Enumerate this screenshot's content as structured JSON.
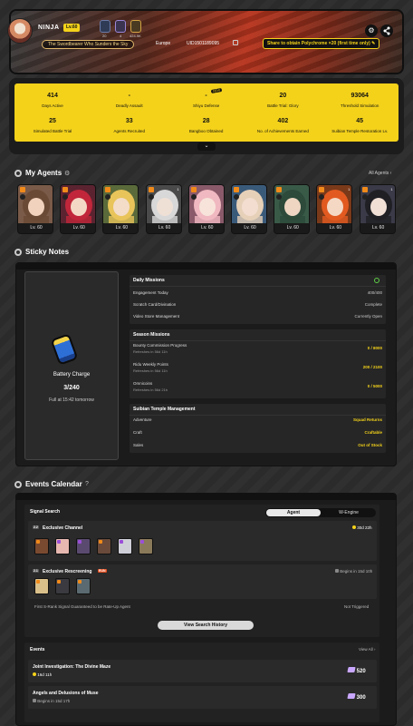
{
  "profile": {
    "name": "NINJA",
    "level": "Lv.60",
    "medals": [
      "20",
      "4",
      "424.9K"
    ],
    "title": "The Swordbearer Who Sunders the Sky",
    "region": "Europe",
    "uid": "UID1501189095",
    "share_promo": "Share to obtain Polychrome ×20 (first time only)"
  },
  "stats": [
    {
      "value": "414",
      "label": "Days Active"
    },
    {
      "value": "-",
      "label": "Deadly Assault"
    },
    {
      "value": "-",
      "label": "Shiyu Defense"
    },
    {
      "value": "20",
      "label": "Battle Trial: Glory"
    },
    {
      "value": "93064",
      "label": "Threshold Simulation"
    },
    {
      "value": "25",
      "label": "Simulated Battle Trial"
    },
    {
      "value": "33",
      "label": "Agents Recruited"
    },
    {
      "value": "28",
      "label": "Bangboo Obtained"
    },
    {
      "value": "402",
      "label": "No. of Achievements Earned"
    },
    {
      "value": "45",
      "label": "Suibian Temple Restoration Lv."
    }
  ],
  "new_tag": "NEW",
  "agents_section": {
    "title": "My Agents",
    "all_link": "All Agents",
    "agents": [
      {
        "level": "Lv. 60",
        "hair": "#6a4a35",
        "skin": "#f1d2bd",
        "bg": "#7a5a48",
        "cons": ""
      },
      {
        "level": "Lv. 60",
        "hair": "#c1263a",
        "skin": "#f4d8c6",
        "bg": "#5b2330",
        "cons": ""
      },
      {
        "level": "Lv. 60",
        "hair": "#e8c45a",
        "skin": "#f3dcc8",
        "bg": "#5a6a3a",
        "cons": ""
      },
      {
        "level": "Lv. 60",
        "hair": "#d8d8d8",
        "skin": "#efe0d6",
        "bg": "#4a4a4a",
        "cons": "1"
      },
      {
        "level": "Lv. 60",
        "hair": "#f0b8c0",
        "skin": "#f7e3da",
        "bg": "#8a5a6a",
        "cons": ""
      },
      {
        "level": "Lv. 60",
        "hair": "#e6d0b8",
        "skin": "#f2ddd0",
        "bg": "#3a5a7a",
        "cons": ""
      },
      {
        "level": "Lv. 60",
        "hair": "#2d4a3a",
        "skin": "#eed6c2",
        "bg": "#3a5a48",
        "cons": ""
      },
      {
        "level": "Lv. 60",
        "hair": "#e25a20",
        "skin": "#f4d8c4",
        "bg": "#7a3a1a",
        "cons": "1"
      },
      {
        "level": "Lv. 60",
        "hair": "#1f1f24",
        "skin": "#f1dfd6",
        "bg": "#3a3a48",
        "cons": "1"
      }
    ]
  },
  "sticky": {
    "title": "Sticky Notes",
    "battery": {
      "label": "Battery Charge",
      "value": "3/240",
      "full_at": "Full at 15:42 tomorrow"
    },
    "daily": {
      "title": "Daily Missions",
      "rows": [
        {
          "k": "Engagement Today",
          "v": "400/400"
        },
        {
          "k": "Scratch Card/Divination",
          "v": "Complete"
        },
        {
          "k": "Video Store Management",
          "v": "Currently Open"
        }
      ]
    },
    "season": {
      "title": "Season Missions",
      "rows": [
        {
          "k": "Bounty Commission Progress",
          "s": "Refreshes in 56d 11h",
          "v": "0 / 8000"
        },
        {
          "k": "Ridu Weekly Points",
          "s": "Refreshes in 56d 11h",
          "v": "200 / 2100"
        },
        {
          "k": "Omnicoins",
          "s": "Refreshes in 56d 21h",
          "v": "0 / 5000"
        }
      ]
    },
    "temple": {
      "title": "Suibian Temple Management",
      "rows": [
        {
          "k": "Adventure",
          "v": "Squad Returns"
        },
        {
          "k": "Craft",
          "v": "Craftable"
        },
        {
          "k": "Sales",
          "v": "Out of Stock"
        }
      ]
    }
  },
  "events_calendar": {
    "title": "Events Calendar",
    "signal": {
      "title": "Signal Search",
      "tabs": [
        "Agent",
        "W-Engine"
      ],
      "exclusive": {
        "badge": "2.2",
        "title": "Exclusive Channel",
        "timer": "30d 22h"
      },
      "rerun": {
        "badge": "2.1",
        "title": "Exclusive Rescreening",
        "tag": "RUN",
        "timer": "Begins in 15d 10h"
      },
      "guarantee": {
        "label": "First S-Rank Signal Guaranteed to be Rate-Up Agent",
        "value": "Not Triggered"
      },
      "view_button": "View Search History"
    },
    "events": {
      "title": "Events",
      "view_all": "View All",
      "items": [
        {
          "name": "Joint Investigation: The Divine Maze",
          "time": "16d 11h",
          "reward": "520"
        },
        {
          "name": "Angels and Delusions of Muse",
          "time": "Begins in 15d 17h",
          "reward": "300"
        }
      ]
    }
  },
  "colors": {
    "accent": "#f4d21a",
    "bg": "#2b2b2b",
    "panel": "#1b1b1b"
  }
}
